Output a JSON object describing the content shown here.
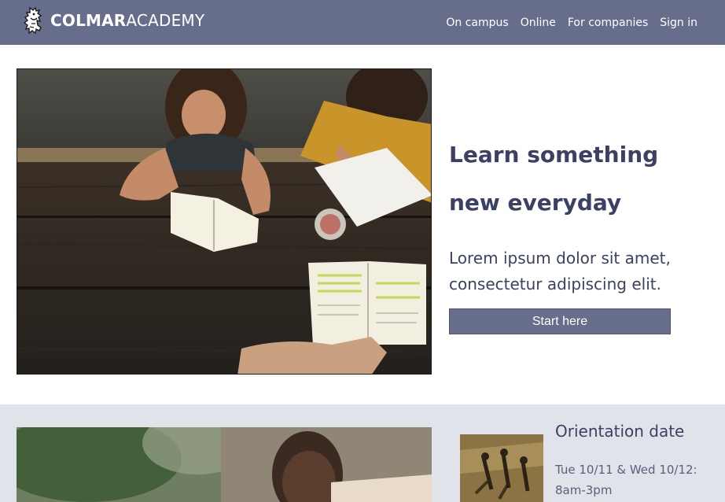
{
  "brand": {
    "name_bold": "COLMAR",
    "name_regular": "ACADEMY"
  },
  "nav": {
    "items": [
      {
        "label": "On campus"
      },
      {
        "label": "Online"
      },
      {
        "label": "For companies"
      },
      {
        "label": "Sign in"
      }
    ]
  },
  "hero": {
    "title_line1": "Learn something",
    "title_line2": "new everyday",
    "subtitle_line1": "Lorem ipsum dolor sit amet,",
    "subtitle_line2": "consectetur adipiscing elit.",
    "cta_label": "Start here"
  },
  "event": {
    "title": "Orientation date",
    "when_line1": "Tue 10/11 & Wed 10/12:",
    "when_line2": "8am-3pm"
  },
  "colors": {
    "navbar": "#666e8c",
    "accent_text": "#3b4163",
    "section_bg": "#e1e3ea",
    "button": "#666e8c"
  },
  "icons": {
    "logo": "lion-rampant-icon"
  }
}
